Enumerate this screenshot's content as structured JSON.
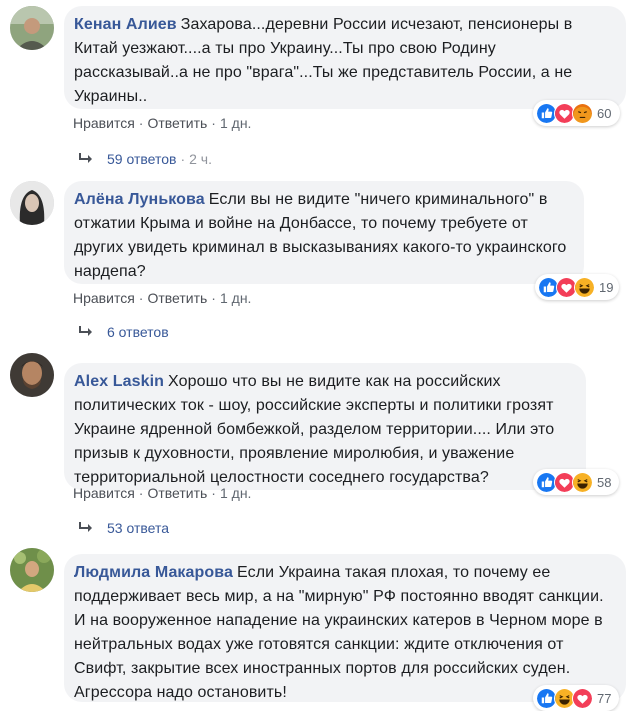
{
  "comments": [
    {
      "author": "Кенан Алиев",
      "text": "Захарова...деревни России исчезают, пенсионеры в Китай уезжают....а ты про Украину...Ты про свою Родину рассказывай..а не про \"врага\"...Ты же представитель России, а не Украины..",
      "like": "Нравится",
      "reply": "Ответить",
      "time": "1 дн.",
      "reaction_count": "60",
      "reactions": [
        "like-icon",
        "love-icon",
        "angry-icon"
      ],
      "replies_count": "59 ответов",
      "replies_time": "2 ч."
    },
    {
      "author": "Алёна Лунькова",
      "text": "Если вы не видите \"ничего криминального\" в отжатии Крыма и войне на Донбассе, то почему требуете от других увидеть криминал в высказываниях какого-то украинского нардепа?",
      "like": "Нравится",
      "reply": "Ответить",
      "time": "1 дн.",
      "reaction_count": "19",
      "reactions": [
        "like-icon",
        "love-icon",
        "haha-icon"
      ],
      "replies_count": "6 ответов",
      "replies_time": ""
    },
    {
      "author": "Alex Laskin",
      "text": "Хорошо что вы не видите как на российских политических ток - шоу, российские эксперты и политики грозят Украине ядренной бомбежкой, разделом территории.... Или это призыв к духовности, проявление миролюбия, и уважение территориальной целостности соседнего государства?",
      "like": "Нравится",
      "reply": "Ответить",
      "time": "1 дн.",
      "reaction_count": "58",
      "reactions": [
        "like-icon",
        "love-icon",
        "haha-icon"
      ],
      "replies_count": "53 ответа",
      "replies_time": ""
    },
    {
      "author": "Людмила Макарова",
      "text": "Если Украина такая плохая, то почему ее поддерживает весь мир, а на \"мирную\" РФ постоянно вводят санкции. И на вооруженное нападение на украинских катеров в Черном море в нейтральных водах уже готовятся санкции: ждите отключения от Свифт, закрытие всех иностранных портов для российских суден. Агрессора надо остановить!",
      "reaction_count": "77",
      "reactions": [
        "like-icon",
        "haha-icon",
        "love-icon"
      ]
    }
  ],
  "colors": {
    "author": "#385898",
    "bubble": "#f2f3f5",
    "like": "#1877f2",
    "love": "#f33e58",
    "yellow": "#f7b125",
    "angry": "#e9710f"
  }
}
